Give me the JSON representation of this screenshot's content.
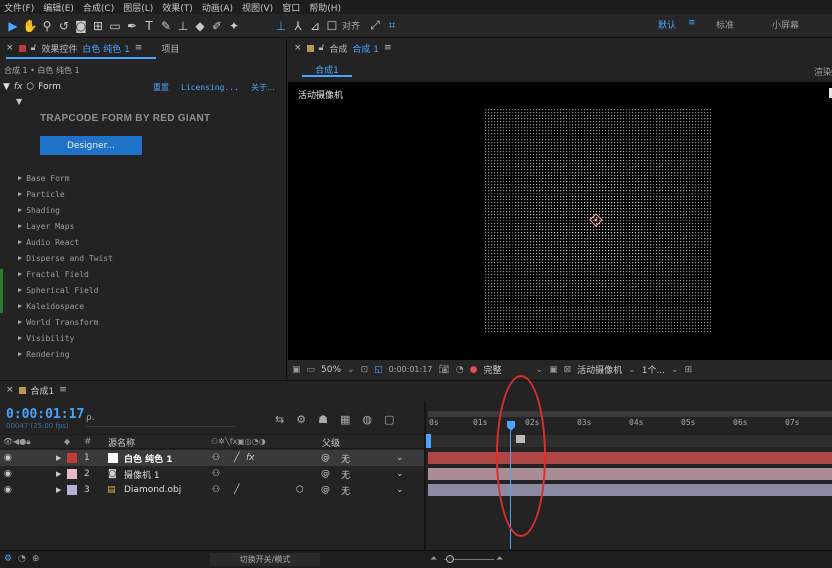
{
  "menu": [
    "文件(F)",
    "编辑(E)",
    "合成(C)",
    "图层(L)",
    "效果(T)",
    "动画(A)",
    "视图(V)",
    "窗口",
    "帮助(H)"
  ],
  "toolbar": {
    "align_label": "对齐",
    "workspaces": [
      "默认",
      "标准",
      "小屏幕"
    ],
    "ws_sep": "≡"
  },
  "effects_panel": {
    "tab_label": "效果控件",
    "layer_name": "白色 纯色 1",
    "menu_glyph": "≡",
    "project_tab": "项目",
    "breadcrumb": "合成 1 • 白色 纯色 1",
    "fx_label": "fx",
    "effect_name": "Form",
    "reset": "重置",
    "licensing": "Licensing...",
    "about": "关于...",
    "brand": "TRAPCODE FORM BY RED GIANT",
    "designer_button": "Designer...",
    "groups": [
      "Base Form",
      "Particle",
      "Shading",
      "Layer Maps",
      "Audio React",
      "Disperse and Twist",
      "Fractal Field",
      "Spherical Field",
      "Kaleidospace",
      "World Transform",
      "Visibility",
      "Rendering"
    ]
  },
  "comp_panel": {
    "tab_prefix": "合成",
    "comp_name": "合成 1",
    "menu_glyph": "≡",
    "subtab": "合成1",
    "right_edge": "渲染",
    "camera_label": "活动摄像机"
  },
  "viewer_footer": {
    "zoom": "50%",
    "timecode": "0:00:01:17",
    "quality": "完整",
    "camera": "活动摄像机",
    "views": "1个..."
  },
  "timeline": {
    "tab": "合成1",
    "menu_glyph": "≡",
    "timecode": "0:00:01:17",
    "fps": "00047 (25.00 fps)",
    "search_placeholder": "ρ.",
    "col_source": "源名称",
    "col_parent": "父级",
    "col_num": "#",
    "ruler": [
      "0s",
      "01s",
      "02s",
      "03s",
      "04s",
      "05s",
      "06s",
      "07s"
    ],
    "layers": [
      {
        "num": "1",
        "name": "白色 纯色 1",
        "color": "#c23b3b",
        "parent": "无",
        "fx": "fx"
      },
      {
        "num": "2",
        "name": "摄像机 1",
        "color": "#e8b7c7",
        "parent": "无",
        "fx": ""
      },
      {
        "num": "3",
        "name": "Diamond.obj",
        "color": "#b8b0d8",
        "parent": "无",
        "fx": ""
      }
    ],
    "footer_toggle": "切换开关/模式"
  },
  "colors": {
    "accent": "#4aa3ff",
    "layer1_bar": "#b04747",
    "layer2_bar": "#a98c96",
    "layer3_bar": "#8d8aa4",
    "annotation": "#d83030"
  }
}
